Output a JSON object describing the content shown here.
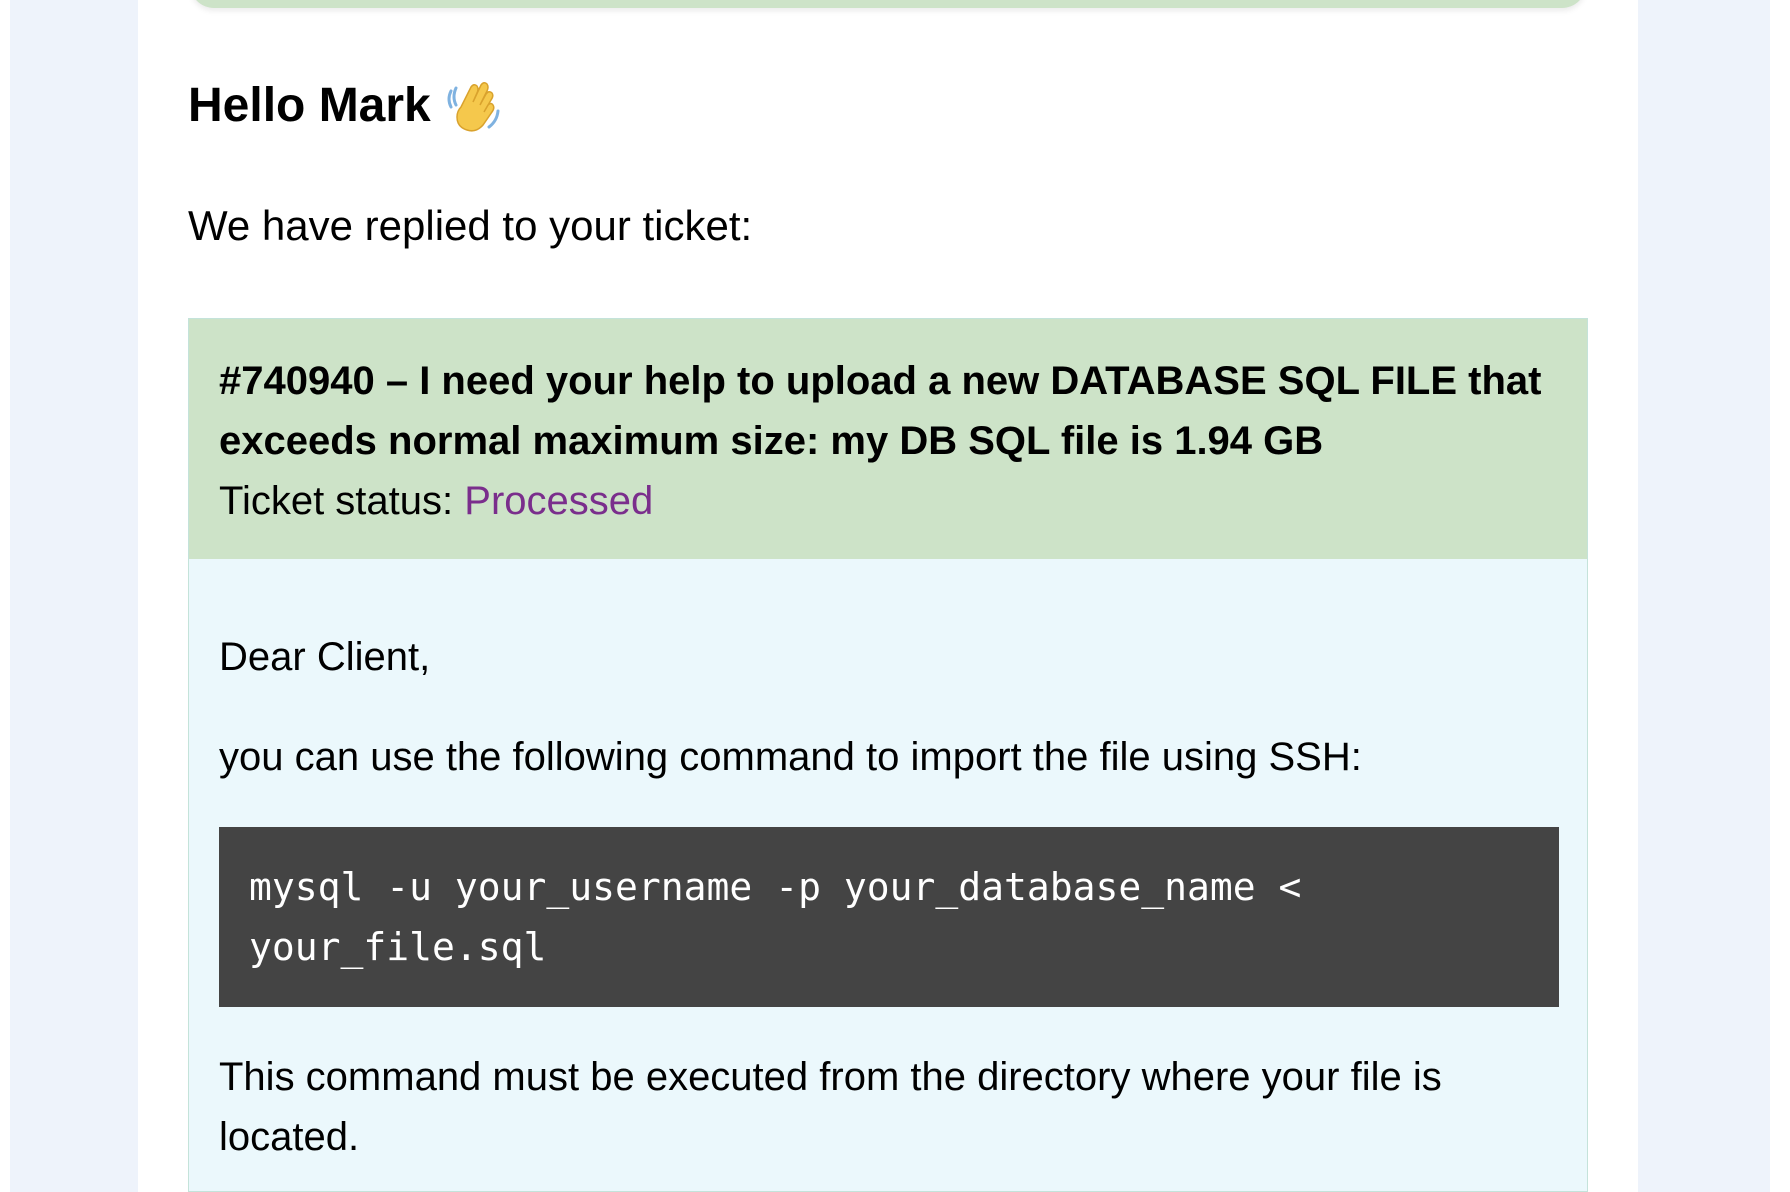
{
  "email": {
    "greeting": "Hello Mark",
    "greeting_icon": "waving-hand-icon",
    "intro": "We have replied to your ticket:"
  },
  "ticket": {
    "title": "#740940 – I need your help to upload a new DATABASE SQL FILE that exceeds normal maximum size: my DB SQL file is 1.94 GB",
    "status_label": "Ticket status: ",
    "status_value": "Processed",
    "status_color": "#7a2e8c",
    "header_color": "#cde3c8",
    "body_color": "#ebf8fc"
  },
  "reply": {
    "salutation": "Dear Client,",
    "instruction": "you can use the following command to import the file using SSH:",
    "command": "mysql -u your_username -p your_database_name < your_file.sql",
    "note": "This command must be executed from the directory where your file is located."
  }
}
